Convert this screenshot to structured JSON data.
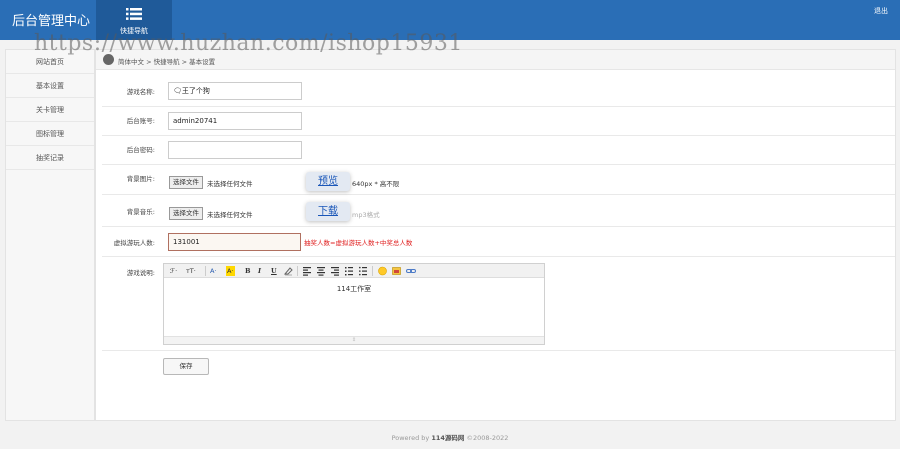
{
  "header": {
    "brand": "后台管理中心",
    "nav_label": "快捷导航",
    "logout": "退出",
    "accent_color": "#2a6eb6"
  },
  "watermark": "https://www.huzhan.com/ishop15931",
  "sidebar": {
    "items": [
      {
        "label": "网站首页"
      },
      {
        "label": "基本设置"
      },
      {
        "label": "关卡管理"
      },
      {
        "label": "图标管理"
      },
      {
        "label": "抽奖记录"
      }
    ]
  },
  "breadcrumb": "简体中文 > 快捷导航 > 基本设置",
  "form": {
    "game_name": {
      "label": "游戏名称:",
      "value": "🗨王了个狗"
    },
    "admin_account": {
      "label": "后台账号:",
      "value": "admin20741"
    },
    "admin_password": {
      "label": "后台密码:",
      "value": ""
    },
    "bg_image": {
      "label": "背景图片:",
      "button": "选择文件",
      "status": "未选择任何文件",
      "preview": "预览",
      "hint": "640px * 高不限"
    },
    "bg_music": {
      "label": "背景音乐:",
      "button": "选择文件",
      "status": "未选择任何文件",
      "download": "下载",
      "hint": "mp3格式"
    },
    "virtual_players": {
      "label": "虚拟游玩人数:",
      "value": "131001",
      "hint": "抽奖人数=虚拟游玩人数+中奖总人数"
    },
    "description": {
      "label": "游戏说明:",
      "content": "114工作室"
    }
  },
  "editor_toolbar": {
    "font_family": "ℱ·",
    "font_size": "тT·",
    "font_color": "A·",
    "bg_color": "A·",
    "bold": "B",
    "italic": "I",
    "underline": "U",
    "resize_grip": "⇳"
  },
  "save_button": "保存",
  "footer": {
    "prefix": "Powered by ",
    "site": "114源码网",
    "suffix": " ©2008-2022"
  }
}
